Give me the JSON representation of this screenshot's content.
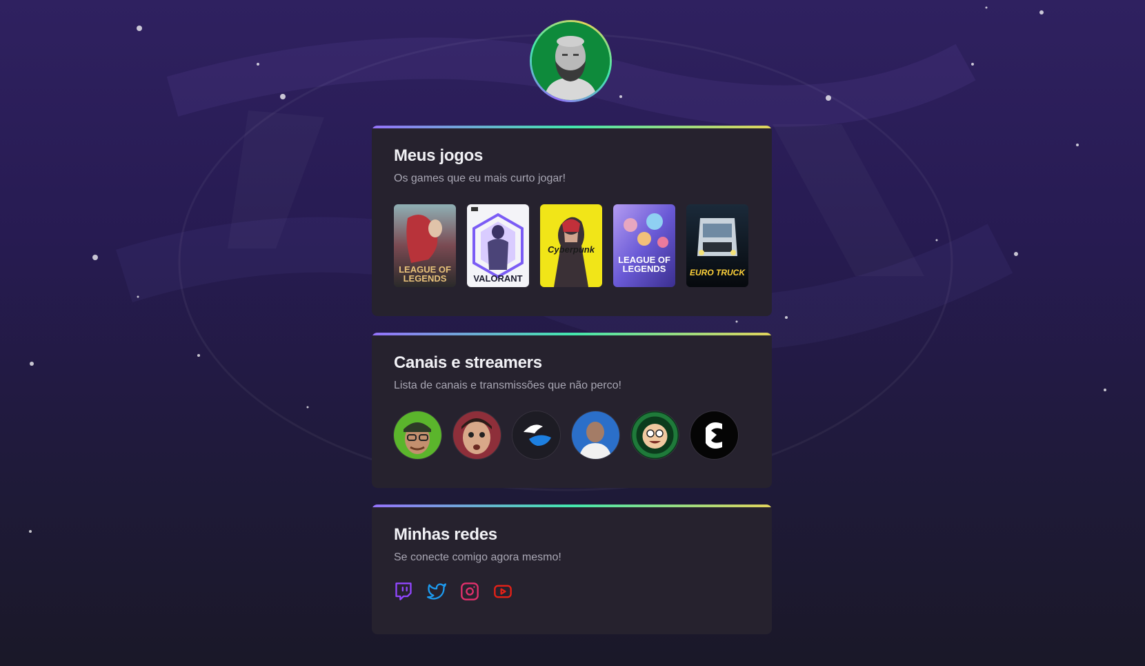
{
  "profile": {
    "avatar_icon": "profile-avatar-photo",
    "avatar_bg": "#0e8a3b"
  },
  "games_section": {
    "title": "Meus jogos",
    "subtitle": "Os games que eu mais curto jogar!",
    "games": [
      {
        "title": "LEAGUE OF\nLEGENDS",
        "color": "#e8c27a"
      },
      {
        "title": "VALORANT",
        "color": "#1a1a2e"
      },
      {
        "title": "Cyberpunk",
        "color": "#1a1a1a"
      },
      {
        "title": "LEAGUE OF\nLEGENDS",
        "color": "#ffffff"
      },
      {
        "title": "EURO TRUCK",
        "color": "#ffd23a"
      }
    ]
  },
  "streamers_section": {
    "title": "Canais e streamers",
    "subtitle": "Lista de canais e transmissões que não perco!",
    "streamers": [
      {
        "icon": "streamer-avatar-1"
      },
      {
        "icon": "streamer-avatar-2"
      },
      {
        "icon": "winged-logo-avatar"
      },
      {
        "icon": "streamer-avatar-4"
      },
      {
        "icon": "casimiro-avatar"
      },
      {
        "icon": "lightning-logo-avatar"
      }
    ]
  },
  "socials_section": {
    "title": "Minhas redes",
    "subtitle": "Se conecte comigo agora mesmo!",
    "links": [
      {
        "icon": "twitch-icon",
        "color": "#9146ff"
      },
      {
        "icon": "twitter-icon",
        "color": "#1d9bf0"
      },
      {
        "icon": "instagram-icon",
        "color": "#e1306c"
      },
      {
        "icon": "youtube-icon",
        "color": "#e62117"
      }
    ]
  },
  "theme": {
    "gradient": [
      "#9572fc",
      "#43e7ad",
      "#e2d45c"
    ],
    "card_bg": "#26222e"
  }
}
